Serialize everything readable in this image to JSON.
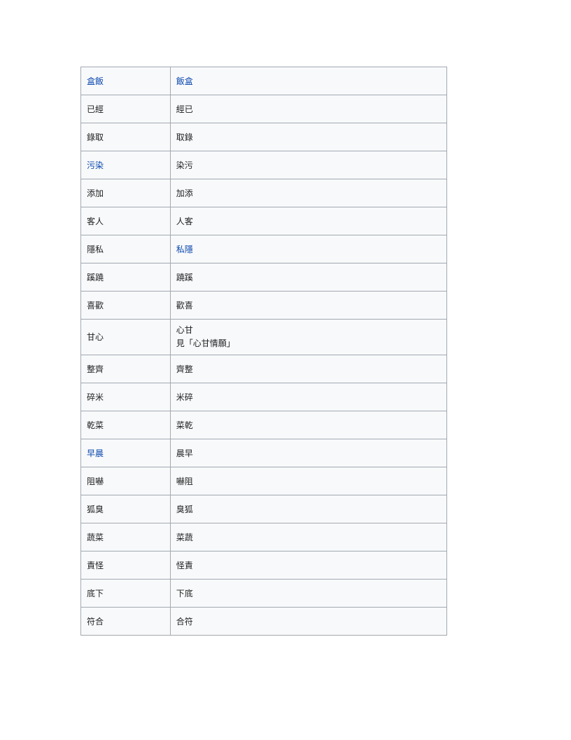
{
  "rows": [
    {
      "left": "盒飯",
      "left_link": true,
      "right": "飯盒",
      "right_link": true
    },
    {
      "left": "已經",
      "left_link": false,
      "right": "經已",
      "right_link": false
    },
    {
      "left": "錄取",
      "left_link": false,
      "right": "取錄",
      "right_link": false
    },
    {
      "left": "污染",
      "left_link": true,
      "right": "染污",
      "right_link": false
    },
    {
      "left": "添加",
      "left_link": false,
      "right": "加添",
      "right_link": false
    },
    {
      "left": "客人",
      "left_link": false,
      "right": "人客",
      "right_link": false
    },
    {
      "left": "隱私",
      "left_link": false,
      "right": "私隱",
      "right_link": true
    },
    {
      "left": "蹊蹺",
      "left_link": false,
      "right": "蹺蹊",
      "right_link": false
    },
    {
      "left": "喜歡",
      "left_link": false,
      "right": "歡喜",
      "right_link": false
    },
    {
      "left": "甘心",
      "left_link": false,
      "right": "心甘",
      "right_link": false,
      "right_extra": "見「心甘情願」"
    },
    {
      "left": "整齊",
      "left_link": false,
      "right": "齊整",
      "right_link": false
    },
    {
      "left": "碎米",
      "left_link": false,
      "right": "米碎",
      "right_link": false
    },
    {
      "left": "乾菜",
      "left_link": false,
      "right": "菜乾",
      "right_link": false
    },
    {
      "left": "早晨",
      "left_link": true,
      "right": "晨早",
      "right_link": false
    },
    {
      "left": "阻嚇",
      "left_link": false,
      "right": "嚇阻",
      "right_link": false
    },
    {
      "left": "狐臭",
      "left_link": false,
      "right": "臭狐",
      "right_link": false
    },
    {
      "left": "蔬菜",
      "left_link": false,
      "right": "菜蔬",
      "right_link": false
    },
    {
      "left": "責怪",
      "left_link": false,
      "right": "怪責",
      "right_link": false
    },
    {
      "left": "底下",
      "left_link": false,
      "right": "下底",
      "right_link": false
    },
    {
      "left": "符合",
      "left_link": false,
      "right": "合符",
      "right_link": false
    }
  ]
}
